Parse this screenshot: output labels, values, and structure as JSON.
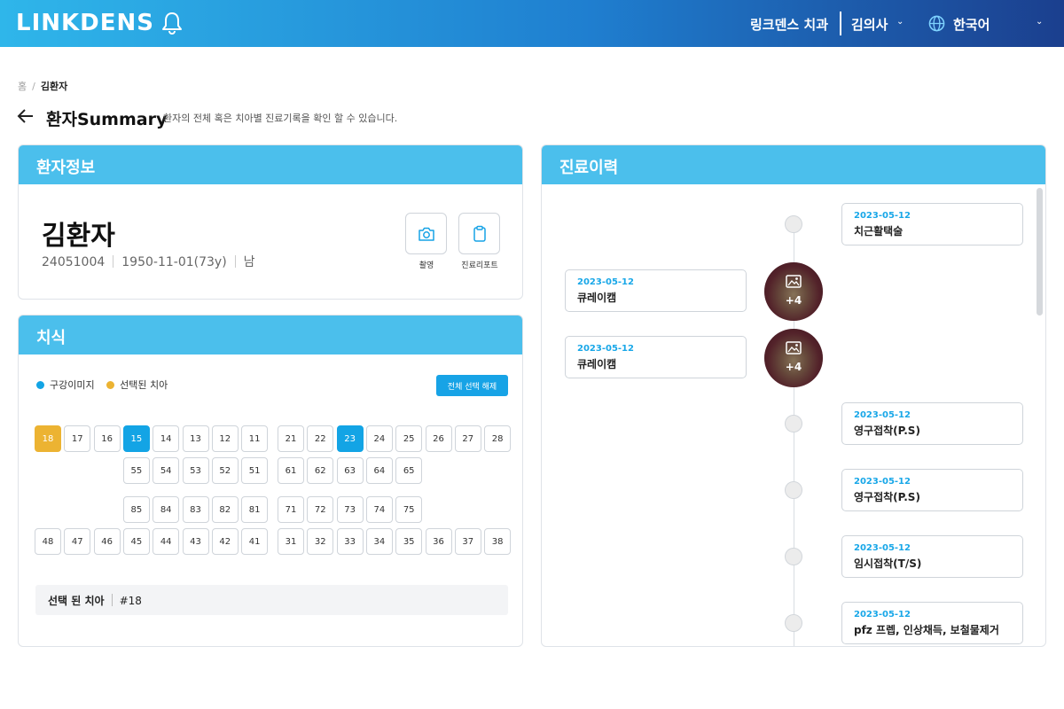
{
  "header": {
    "logo": "LINKDENS",
    "clinic": "링크덴스 치과",
    "user": "김의사",
    "language": "한국어",
    "icons": [
      "bell-icon",
      "chevron-down-icon",
      "globe-icon"
    ]
  },
  "breadcrumb": {
    "home": "홈",
    "sep": "/",
    "current": "김환자"
  },
  "page": {
    "title": "환자Summary",
    "subtitle": "환자의 전체 혹은 치아별 진료기록을 확인 할 수 있습니다."
  },
  "patient_info": {
    "heading": "환자정보",
    "name": "김환자",
    "chart_no": "24051004",
    "birth": "1950-11-01(73y)",
    "gender": "남",
    "actions": [
      {
        "label": "촬영",
        "icon": "camera-icon"
      },
      {
        "label": "진료리포트",
        "icon": "clipboard-icon"
      }
    ]
  },
  "dental": {
    "heading": "치식",
    "legend": [
      {
        "label": "구강이미지",
        "color": "#13a4e5"
      },
      {
        "label": "선택된 치아",
        "color": "#ecb332"
      }
    ],
    "deselect_label": "전체 선택 해제",
    "rows": {
      "upper_perm_right": [
        "18",
        "17",
        "16",
        "15",
        "14",
        "13",
        "12",
        "11"
      ],
      "upper_perm_left": [
        "21",
        "22",
        "23",
        "24",
        "25",
        "26",
        "27",
        "28"
      ],
      "upper_prim_right": [
        "55",
        "54",
        "53",
        "52",
        "51"
      ],
      "upper_prim_left": [
        "61",
        "62",
        "63",
        "64",
        "65"
      ],
      "lower_prim_right": [
        "85",
        "84",
        "83",
        "82",
        "81"
      ],
      "lower_prim_left": [
        "71",
        "72",
        "73",
        "74",
        "75"
      ],
      "lower_perm_right": [
        "48",
        "47",
        "46",
        "45",
        "44",
        "43",
        "42",
        "41"
      ],
      "lower_perm_left": [
        "31",
        "32",
        "33",
        "34",
        "35",
        "36",
        "37",
        "38"
      ]
    },
    "image_teeth": [
      "15",
      "23"
    ],
    "selected_teeth": [
      "18"
    ],
    "selected_label": "선택 된 치아",
    "selected_value": "#18"
  },
  "history": {
    "heading": "진료이력",
    "items": [
      {
        "date": "2023-05-12",
        "title": "치근활택술",
        "side": "right"
      },
      {
        "date": "2023-05-12",
        "title": "큐레이캠",
        "side": "left",
        "photos": "+4"
      },
      {
        "date": "2023-05-12",
        "title": "큐레이캠",
        "side": "left",
        "photos": "+4"
      },
      {
        "date": "2023-05-12",
        "title": "영구접착(P.S)",
        "side": "right"
      },
      {
        "date": "2023-05-12",
        "title": "영구접착(P.S)",
        "side": "right"
      },
      {
        "date": "2023-05-12",
        "title": "임시접착(T/S)",
        "side": "right"
      },
      {
        "date": "2023-05-12",
        "title": "pfz 프렙, 인상채득, 보철물제거",
        "side": "right"
      }
    ]
  }
}
